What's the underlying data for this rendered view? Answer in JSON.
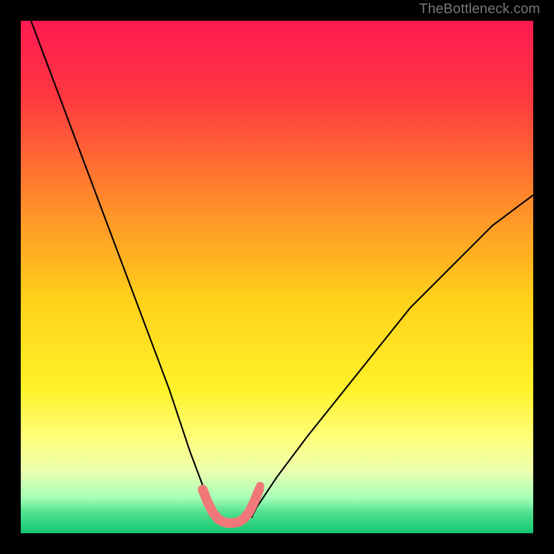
{
  "watermark": "TheBottleneck.com",
  "chart_data": {
    "type": "line",
    "title": "",
    "xlabel": "",
    "ylabel": "",
    "xlim": [
      0,
      100
    ],
    "ylim": [
      0,
      100
    ],
    "grid": false,
    "background_gradient": {
      "stops": [
        {
          "pos": 0.0,
          "color": "#ff1a52"
        },
        {
          "pos": 0.15,
          "color": "#ff3840"
        },
        {
          "pos": 0.35,
          "color": "#ff8a2a"
        },
        {
          "pos": 0.55,
          "color": "#ffd21a"
        },
        {
          "pos": 0.72,
          "color": "#fff22a"
        },
        {
          "pos": 0.82,
          "color": "#ffff80"
        },
        {
          "pos": 0.88,
          "color": "#eaffb0"
        },
        {
          "pos": 0.93,
          "color": "#a8ffb8"
        },
        {
          "pos": 0.96,
          "color": "#50e090"
        },
        {
          "pos": 1.0,
          "color": "#12c770"
        }
      ]
    },
    "series": [
      {
        "name": "left-branch",
        "stroke": "#000000",
        "width": 2.2,
        "x": [
          2,
          5,
          8,
          11,
          14,
          17,
          20,
          23,
          26,
          29,
          31,
          33,
          34.5,
          36,
          37,
          38
        ],
        "y": [
          100,
          92,
          84,
          76,
          68,
          60,
          52,
          44,
          36,
          28,
          22,
          16,
          12,
          8,
          5,
          3
        ]
      },
      {
        "name": "right-branch",
        "stroke": "#000000",
        "width": 2.2,
        "x": [
          45,
          46,
          48,
          50,
          53,
          56,
          60,
          64,
          68,
          72,
          76,
          80,
          84,
          88,
          92,
          96,
          100
        ],
        "y": [
          3,
          5,
          8,
          11,
          15,
          19,
          24,
          29,
          34,
          39,
          44,
          48,
          52,
          56,
          60,
          63,
          66
        ]
      },
      {
        "name": "highlight-segment",
        "stroke": "#f07878",
        "width": 14,
        "linecap": "round",
        "x": [
          35.5,
          36.5,
          37.5,
          38.5,
          39.5,
          40.5,
          41.5,
          42.5,
          43.5,
          44.5,
          45.5,
          46.5
        ],
        "y": [
          8.5,
          6.0,
          4.0,
          2.8,
          2.2,
          2.0,
          2.0,
          2.2,
          2.8,
          4.0,
          6.0,
          8.5
        ]
      }
    ],
    "markers": [
      {
        "name": "highlight-dot-upper",
        "x": 46.7,
        "y": 9.2,
        "r": 6,
        "color": "#f07878"
      }
    ]
  }
}
